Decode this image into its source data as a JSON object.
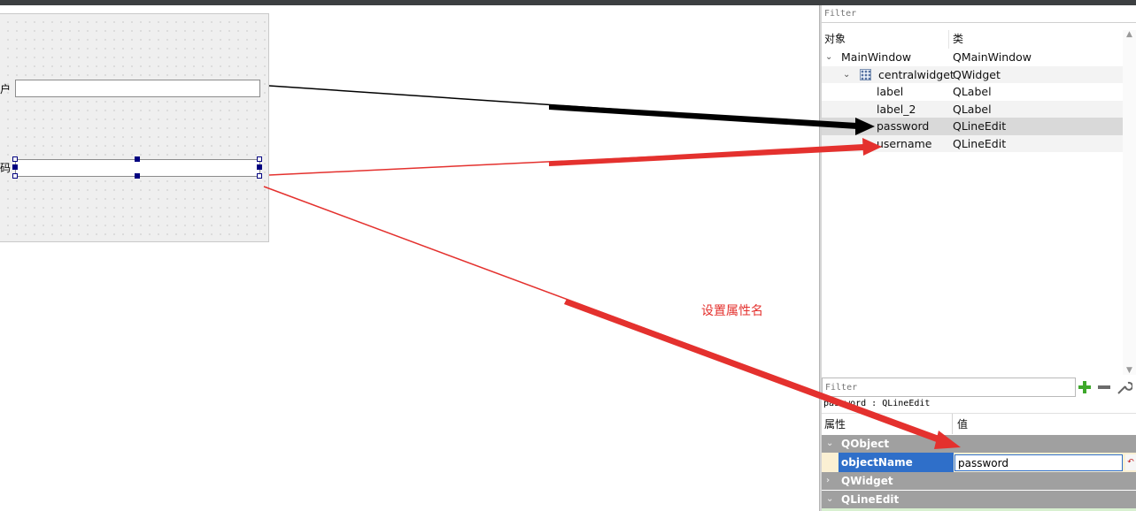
{
  "form": {
    "label_user_fragment": "户",
    "label_pass_fragment": "码"
  },
  "object_inspector": {
    "filter_placeholder": "Filter",
    "columns": [
      "对象",
      "类"
    ],
    "rows": [
      {
        "name": "MainWindow",
        "class": "QMainWindow"
      },
      {
        "name": "centralwidget",
        "class": "QWidget"
      },
      {
        "name": "label",
        "class": "QLabel"
      },
      {
        "name": "label_2",
        "class": "QLabel"
      },
      {
        "name": "password",
        "class": "QLineEdit"
      },
      {
        "name": "username",
        "class": "QLineEdit"
      }
    ]
  },
  "property_editor": {
    "filter_placeholder": "Filter",
    "context": "password : QLineEdit",
    "columns": [
      "属性",
      "值"
    ],
    "groups": [
      "QObject",
      "QWidget",
      "QLineEdit"
    ],
    "object_name_property": "objectName",
    "object_name_value": "password"
  },
  "annotation": {
    "text": "设置属性名",
    "color": "#e4312e"
  },
  "icons": {
    "add": "plus-icon",
    "remove": "minus-icon",
    "configure": "wrench-icon",
    "reset": "reset-arrow-icon"
  },
  "colors": {
    "selection_blue": "#2f6fc9",
    "group_gray": "#a0a0a0",
    "annotation_red": "#e4312e"
  }
}
